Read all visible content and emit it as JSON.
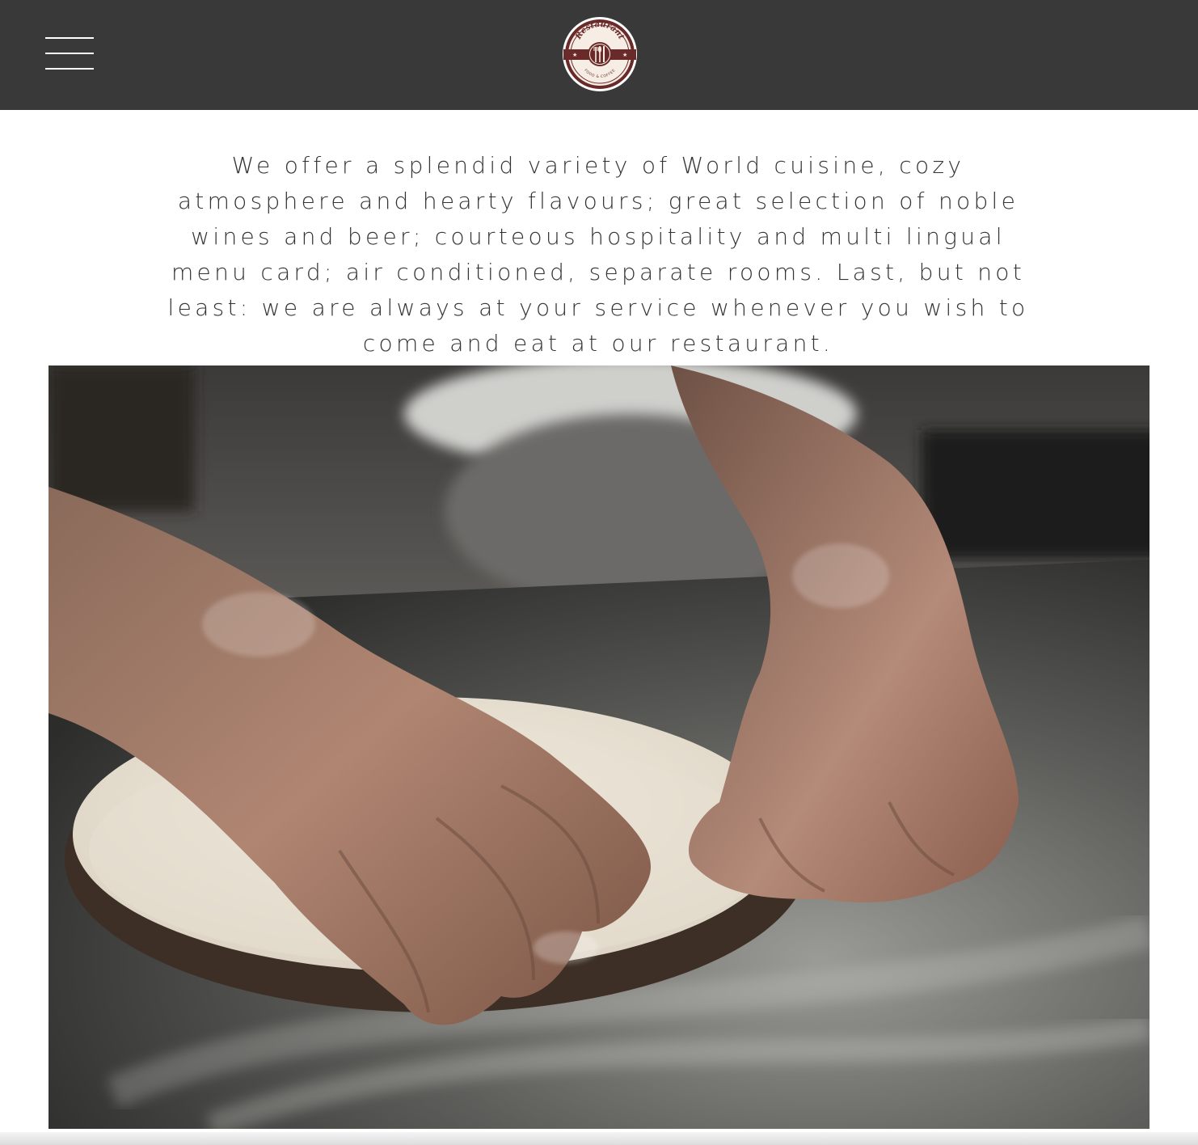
{
  "header": {
    "menu_icon": "hamburger-menu-icon",
    "logo": {
      "icon": "restaurant-logo-icon",
      "title": "Restaurant",
      "subtitle": "FOOD & COFFEE"
    },
    "colors": {
      "bar": "#3a3939",
      "logo_ring": "#6b2a2a"
    }
  },
  "intro": {
    "text": "We offer a splendid variety of World cuisine, cozy atmosphere and hearty flavours; great selection of noble wines and beer; courteous hospitality and multi lingual menu card; air conditioned, separate rooms. Last, but not least: we are always at your service whenever you wish to come and eat at our restaurant."
  },
  "hero_image": {
    "subject": "hands-shaping-pizza-dough-on-floured-counter"
  }
}
